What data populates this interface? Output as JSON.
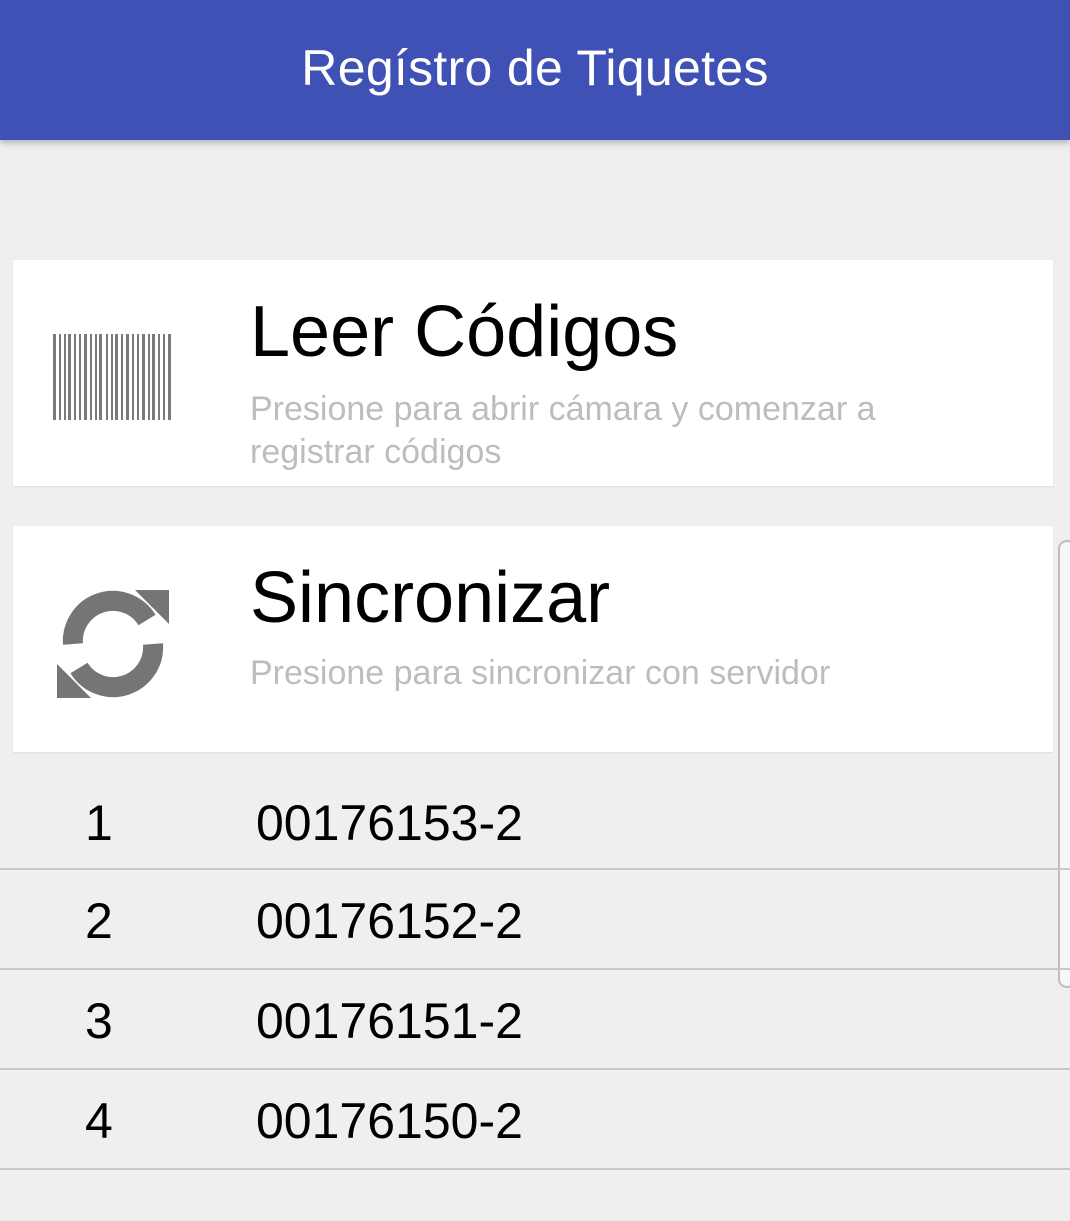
{
  "appbar": {
    "title": "Regístro de Tiquetes",
    "color": "#3f51b5"
  },
  "actions": [
    {
      "icon": "barcode-icon",
      "title": "Leer Códigos",
      "subtitle": "Presione para abrir cámara y comenzar a registrar códigos"
    },
    {
      "icon": "sync-icon",
      "title": "Sincronizar",
      "subtitle": "Presione para sincronizar con servidor"
    }
  ],
  "codes": [
    {
      "index": "1",
      "code": "00176153-2"
    },
    {
      "index": "2",
      "code": "00176152-2"
    },
    {
      "index": "3",
      "code": "00176151-2"
    },
    {
      "index": "4",
      "code": "00176150-2"
    }
  ]
}
